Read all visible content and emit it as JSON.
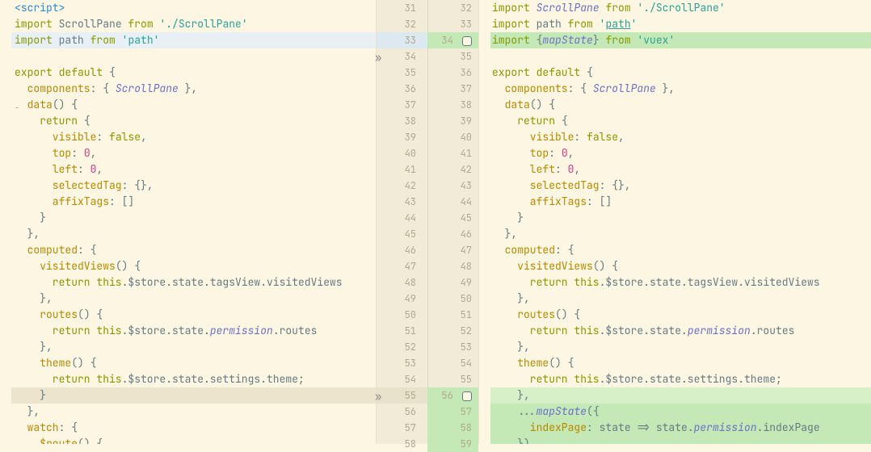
{
  "left_numbers": [
    "31",
    "32",
    "33",
    "34",
    "35",
    "36",
    "37",
    "38",
    "39",
    "40",
    "41",
    "42",
    "43",
    "44",
    "45",
    "46",
    "47",
    "48",
    "49",
    "50",
    "51",
    "52",
    "53",
    "54",
    "55",
    "56",
    "57",
    "58"
  ],
  "right_numbers": [
    "32",
    "33",
    "34",
    "35",
    "36",
    "37",
    "38",
    "39",
    "40",
    "41",
    "42",
    "43",
    "44",
    "45",
    "46",
    "47",
    "48",
    "49",
    "50",
    "51",
    "52",
    "53",
    "54",
    "55",
    "56",
    "57",
    "58",
    "59"
  ],
  "left": {
    "l0_tag_open": "<",
    "l0_tag_name": "script",
    "l0_tag_close": ">",
    "l1_kw": "import",
    "l1_id": " ScrollPane ",
    "l1_from": "from ",
    "l1_str": "'./ScrollPane'",
    "l2_kw": "import",
    "l2_id": " path ",
    "l2_from": "from ",
    "l2_str": "'path'",
    "l4_kw": "export default ",
    "l4_brace": "{",
    "l5_prop": "  components",
    "l5_rest": ": { ",
    "l5_type": "ScrollPane",
    "l5_end": " },",
    "l6_meth": "  data",
    "l6_paren": "() {",
    "l7_kw": "    return ",
    "l7_brace": "{",
    "l8_prop": "      visible",
    "l8_val": ": ",
    "l8_bool": "false",
    "l8_c": ",",
    "l9_prop": "      top",
    "l9_val": ": ",
    "l9_num": "0",
    "l9_c": ",",
    "l10_prop": "      left",
    "l10_val": ": ",
    "l10_num": "0",
    "l10_c": ",",
    "l11_prop": "      selectedTag",
    "l11_val": ": {},",
    "l12_prop": "      affixTags",
    "l12_val": ": []",
    "l13": "    }",
    "l14": "  },",
    "l15_prop": "  computed",
    "l15_rest": ": {",
    "l16_meth": "    visitedViews",
    "l16_paren": "() {",
    "l17_kw": "      return ",
    "l17_this": "this",
    "l17_chain": ".$store.state.tagsView.visitedViews",
    "l18": "    },",
    "l19_meth": "    routes",
    "l19_paren": "() {",
    "l20_kw": "      return ",
    "l20_this": "this",
    "l20_chain1": ".$store.state.",
    "l20_perm": "permission",
    "l20_chain2": ".routes",
    "l21": "    },",
    "l22_meth": "    theme",
    "l22_paren": "() {",
    "l23_kw": "      return ",
    "l23_this": "this",
    "l23_chain": ".$store.state.settings.theme;",
    "l24": "    }",
    "l25": "  },",
    "l26_prop": "  watch",
    "l26_rest": ": {",
    "l27_meth": "    $route",
    "l27_paren": "() {"
  },
  "right": {
    "r0_kw": "import",
    "r0_id": " ",
    "r0_type": "ScrollPane",
    "r0_sp": " ",
    "r0_from": "from ",
    "r0_str": "'./ScrollPane'",
    "r1_kw": "import",
    "r1_id": " path ",
    "r1_from": "from ",
    "r1_str_q": "'",
    "r1_str_mid": "path",
    "r1_str_q2": "'",
    "r2_kw": "import ",
    "r2_brace": "{",
    "r2_map": "mapState",
    "r2_brace2": "} ",
    "r2_from": "from ",
    "r2_str": "'vuex'",
    "r4_kw": "export default ",
    "r4_brace": "{",
    "r5_prop": "  components",
    "r5_rest": ": { ",
    "r5_type": "ScrollPane",
    "r5_end": " },",
    "r6_meth": "  data",
    "r6_paren": "() {",
    "r7_kw": "    return ",
    "r7_brace": "{",
    "r8_prop": "      visible",
    "r8_val": ": ",
    "r8_bool": "false",
    "r8_c": ",",
    "r9_prop": "      top",
    "r9_val": ": ",
    "r9_num": "0",
    "r9_c": ",",
    "r10_prop": "      left",
    "r10_val": ": ",
    "r10_num": "0",
    "r10_c": ",",
    "r11_prop": "      selectedTag",
    "r11_val": ": {},",
    "r12_prop": "      affixTags",
    "r12_val": ": []",
    "r13": "    }",
    "r14": "  },",
    "r15_prop": "  computed",
    "r15_rest": ": {",
    "r16_meth": "    visitedViews",
    "r16_paren": "() {",
    "r17_kw": "      return ",
    "r17_this": "this",
    "r17_chain": ".$store.state.tagsView.visitedViews",
    "r18": "    },",
    "r19_meth": "    routes",
    "r19_paren": "() {",
    "r20_kw": "      return ",
    "r20_this": "this",
    "r20_chain1": ".$store.state.",
    "r20_perm": "permission",
    "r20_chain2": ".routes",
    "r21": "    },",
    "r22_meth": "    theme",
    "r22_paren": "() {",
    "r23_kw": "      return ",
    "r23_this": "this",
    "r23_chain": ".$store.state.settings.theme;",
    "r24": "    },",
    "r25_spread": "    ...",
    "r25_map": "mapState",
    "r25_paren": "({",
    "r26_prop": "      indexPage",
    "r26_rest": ": state => state.",
    "r26_perm": "permission",
    "r26_rest2": ".indexPage",
    "r27": "    })"
  }
}
